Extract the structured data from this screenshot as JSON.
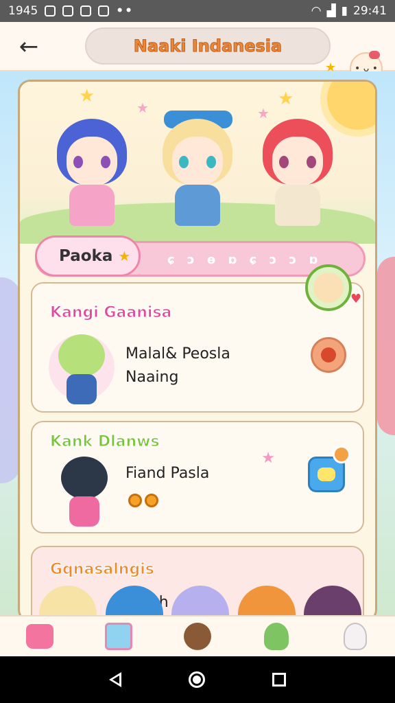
{
  "status_bar": {
    "time_left": "1945",
    "time_right": "29:41",
    "dots": "••"
  },
  "app_bar": {
    "title": "Naaki Indanesia",
    "back_icon": "arrow-left-icon",
    "avatar_icon": "kawaii-face-icon"
  },
  "hero": {
    "banner_tag": "Paoka",
    "banner_deco": "ɕ ɔ ɵ ɒ ɕ ɔ ɔ ɒ"
  },
  "cards": [
    {
      "title": "Kangi Gaanisa",
      "lines": [
        "Malal& Peosla",
        "Naaing"
      ],
      "button_icon": "peach-icon"
    },
    {
      "title": "Kank Dlanws",
      "lines": [
        "Fiand Pasla"
      ],
      "button_icon": "smile-square-icon"
    },
    {
      "title": "Gqnasalngis",
      "lines": [
        "Giach"
      ]
    }
  ],
  "bottom_nav": [
    {
      "icon": "bag-icon"
    },
    {
      "icon": "cup-icon"
    },
    {
      "icon": "cookie-icon"
    },
    {
      "icon": "frog-icon"
    },
    {
      "icon": "ghost-icon"
    }
  ],
  "colors": {
    "accent_pink": "#ef86aa",
    "title_orange": "#e8893a",
    "card_green": "#78c43a"
  }
}
